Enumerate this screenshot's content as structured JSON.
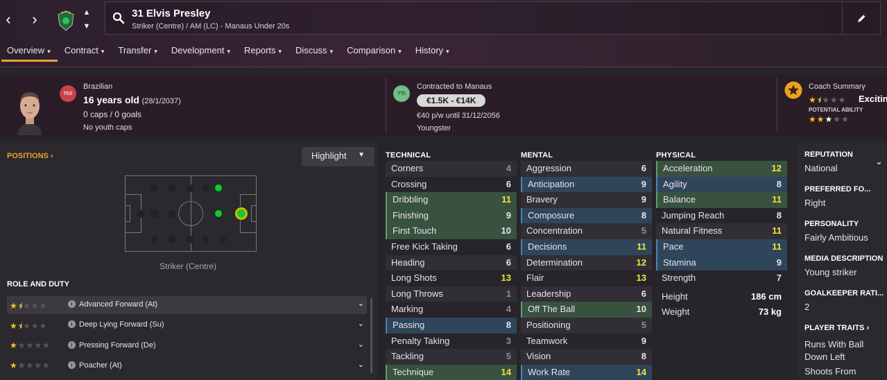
{
  "header": {
    "player_name": "31 Elvis Presley",
    "player_subtitle": "Striker (Centre) / AM (LC) - Manaus Under 20s",
    "nav_back": "‹",
    "nav_forward": "›"
  },
  "tabs": [
    {
      "label": "Overview"
    },
    {
      "label": "Contract"
    },
    {
      "label": "Transfer"
    },
    {
      "label": "Development"
    },
    {
      "label": "Reports"
    },
    {
      "label": "Discuss"
    },
    {
      "label": "Comparison"
    },
    {
      "label": "History"
    }
  ],
  "info": {
    "badge_hol": "Hol",
    "nationality": "Brazilian",
    "age": "16 years old",
    "dob": "(28/1/2037)",
    "caps": "0 caps / 0 goals",
    "youth_caps": "No youth caps",
    "badge_yth": "Yth",
    "contract_label": "Contracted to Manaus",
    "value_range": "€1.5K - €14K",
    "wage": "€40 p/w until 31/12/2056",
    "status": "Youngster",
    "coach_summary_label": "Coach Summary",
    "coach_summary_value": "Exciting",
    "potential_label": "POTENTIAL ABILITY",
    "current_ability_stars": 1.5,
    "potential_ability_stars": 2.5
  },
  "positions": {
    "label": "POSITIONS",
    "highlight_button": "Highlight",
    "caption": "Striker (Centre)"
  },
  "roles": {
    "label": "ROLE AND DUTY",
    "items": [
      {
        "name": "Advanced Forward (At)",
        "stars": 1.5
      },
      {
        "name": "Deep Lying Forward (Su)",
        "stars": 1.5
      },
      {
        "name": "Pressing Forward (De)",
        "stars": 1
      },
      {
        "name": "Poacher (At)",
        "stars": 1
      }
    ]
  },
  "technical": {
    "label": "TECHNICAL",
    "rows": [
      {
        "name": "Corners",
        "value": "4"
      },
      {
        "name": "Crossing",
        "value": "6"
      },
      {
        "name": "Dribbling",
        "value": "11"
      },
      {
        "name": "Finishing",
        "value": "9"
      },
      {
        "name": "First Touch",
        "value": "10"
      },
      {
        "name": "Free Kick Taking",
        "value": "6"
      },
      {
        "name": "Heading",
        "value": "6"
      },
      {
        "name": "Long Shots",
        "value": "13"
      },
      {
        "name": "Long Throws",
        "value": "1"
      },
      {
        "name": "Marking",
        "value": "4"
      },
      {
        "name": "Passing",
        "value": "8"
      },
      {
        "name": "Penalty Taking",
        "value": "3"
      },
      {
        "name": "Tackling",
        "value": "5"
      },
      {
        "name": "Technique",
        "value": "14"
      }
    ]
  },
  "mental": {
    "label": "MENTAL",
    "rows": [
      {
        "name": "Aggression",
        "value": "6"
      },
      {
        "name": "Anticipation",
        "value": "9"
      },
      {
        "name": "Bravery",
        "value": "9"
      },
      {
        "name": "Composure",
        "value": "8"
      },
      {
        "name": "Concentration",
        "value": "5"
      },
      {
        "name": "Decisions",
        "value": "11"
      },
      {
        "name": "Determination",
        "value": "12"
      },
      {
        "name": "Flair",
        "value": "13"
      },
      {
        "name": "Leadership",
        "value": "6"
      },
      {
        "name": "Off The Ball",
        "value": "10"
      },
      {
        "name": "Positioning",
        "value": "5"
      },
      {
        "name": "Teamwork",
        "value": "9"
      },
      {
        "name": "Vision",
        "value": "8"
      },
      {
        "name": "Work Rate",
        "value": "14"
      }
    ]
  },
  "physical": {
    "label": "PHYSICAL",
    "rows": [
      {
        "name": "Acceleration",
        "value": "12"
      },
      {
        "name": "Agility",
        "value": "8"
      },
      {
        "name": "Balance",
        "value": "11"
      },
      {
        "name": "Jumping Reach",
        "value": "8"
      },
      {
        "name": "Natural Fitness",
        "value": "11"
      },
      {
        "name": "Pace",
        "value": "11"
      },
      {
        "name": "Stamina",
        "value": "9"
      },
      {
        "name": "Strength",
        "value": "7"
      }
    ],
    "height_label": "Height",
    "height_value": "186 cm",
    "weight_label": "Weight",
    "weight_value": "73 kg"
  },
  "sidebar": {
    "reputation_label": "REPUTATION",
    "reputation_value": "National",
    "preferred_foot_label": "PREFERRED FO...",
    "preferred_foot_value": "Right",
    "personality_label": "PERSONALITY",
    "personality_value": "Fairly Ambitious",
    "media_label": "MEDIA DESCRIPTION",
    "media_value": "Young striker",
    "gk_label": "GOALKEEPER RATI...",
    "gk_value": "2",
    "traits_label": "PLAYER TRAITS",
    "traits": [
      "Runs With Ball",
      "Down Left",
      "Shoots From"
    ]
  },
  "colors": {
    "accent": "#f0a040",
    "highlight_value": "#f3e53b",
    "key_green": "#39513f",
    "key_blue": "#2f4559"
  }
}
